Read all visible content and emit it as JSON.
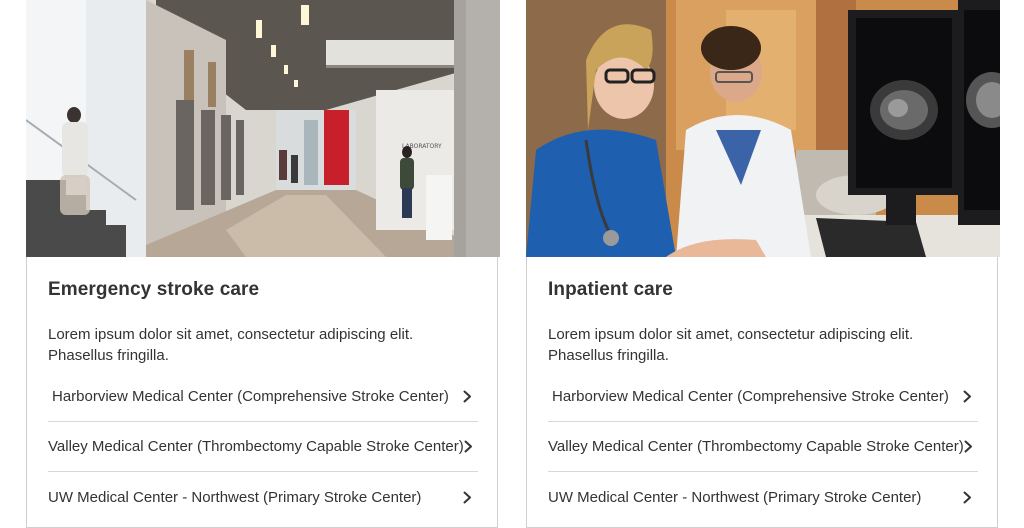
{
  "cards": [
    {
      "title": "Emergency stroke care",
      "description": "Lorem ipsum dolor sit amet, consectetur adipiscing elit. Phasellus fringilla.",
      "links": [
        {
          "label": "Harborview Medical Center (Comprehensive Stroke Center)"
        },
        {
          "label": "Valley Medical Center (Thrombectomy Capable Stroke Center)"
        },
        {
          "label": "UW Medical Center - Northwest (Primary Stroke Center)"
        }
      ],
      "image_sign": "LABORATORY"
    },
    {
      "title": "Inpatient care",
      "description": "Lorem ipsum dolor sit amet, consectetur adipiscing elit. Phasellus fringilla.",
      "links": [
        {
          "label": "Harborview Medical Center (Comprehensive Stroke Center)"
        },
        {
          "label": "Valley Medical Center (Thrombectomy Capable Stroke Center)"
        },
        {
          "label": "UW Medical Center - Northwest (Primary Stroke Center)"
        }
      ]
    }
  ],
  "colors": {
    "text": "#333333",
    "border": "#cfcfcf",
    "divider": "#d8d8d8",
    "accent_red": "#c8202a"
  },
  "icons": [
    "chevron-right-icon"
  ]
}
